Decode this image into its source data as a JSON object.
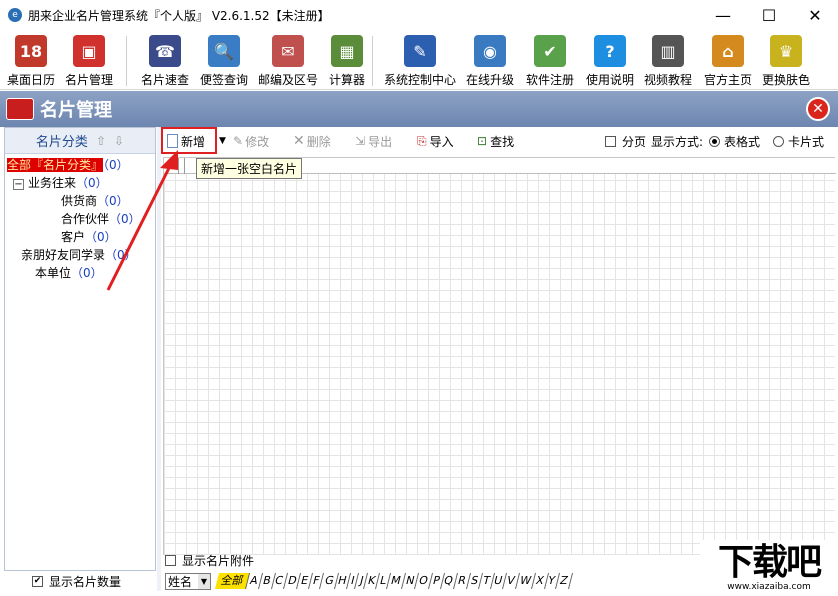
{
  "window": {
    "title": "朋来企业名片管理系统『个人版』 V2.6.1.52【未注册】",
    "minimize": "—",
    "maximize": "☐",
    "close": "✕"
  },
  "toolbar": {
    "items": [
      {
        "label": "桌面日历",
        "icon": "calendar-icon",
        "glyph": "18",
        "color": "#c0392b"
      },
      {
        "label": "名片管理",
        "icon": "cards-icon",
        "glyph": "▣",
        "color": "#d0312d"
      },
      {
        "label": "名片速查",
        "icon": "address-book-icon",
        "glyph": "☎",
        "color": "#3b4a8a"
      },
      {
        "label": "便签查询",
        "icon": "magnifier-icon",
        "glyph": "🔍",
        "color": "#3b7dc4"
      },
      {
        "label": "邮编及区号",
        "icon": "postcode-icon",
        "glyph": "✉",
        "color": "#c0504d"
      },
      {
        "label": "计算器",
        "icon": "calculator-icon",
        "glyph": "▦",
        "color": "#5b8c3a"
      },
      {
        "label": "系统控制中心",
        "icon": "control-center-icon",
        "glyph": "✎",
        "color": "#2d5fb0"
      },
      {
        "label": "在线升级",
        "icon": "globe-icon",
        "glyph": "◉",
        "color": "#3a7ac0"
      },
      {
        "label": "软件注册",
        "icon": "register-icon",
        "glyph": "✔",
        "color": "#5aa14b"
      },
      {
        "label": "使用说明",
        "icon": "help-icon",
        "glyph": "?",
        "color": "#1e8fe0"
      },
      {
        "label": "视频教程",
        "icon": "film-icon",
        "glyph": "▥",
        "color": "#555555"
      },
      {
        "label": "官方主页",
        "icon": "home-icon",
        "glyph": "⌂",
        "color": "#d48a1e"
      },
      {
        "label": "更换肤色",
        "icon": "skin-icon",
        "glyph": "♛",
        "color": "#c8b21e"
      }
    ]
  },
  "header": {
    "title": "名片管理",
    "close": "✕"
  },
  "left": {
    "title": "名片分类",
    "up": "⇧",
    "down": "⇩",
    "tree": [
      {
        "label": "全部『名片分类』",
        "count": "（0）"
      },
      {
        "label": "业务往来",
        "count": "（0）"
      },
      {
        "label": "供货商",
        "count": "（0）"
      },
      {
        "label": "合作伙伴",
        "count": "（0）"
      },
      {
        "label": "客户",
        "count": "（0）"
      },
      {
        "label": "亲朋好友同学录",
        "count": "（0）"
      },
      {
        "label": "本单位",
        "count": "（0）"
      }
    ],
    "expander": "−",
    "footer_checkbox": "显示名片数量",
    "footer_check": "✔"
  },
  "subbar": {
    "new": "新增",
    "edit": "修改",
    "delete": "删除",
    "export": "导出",
    "import": "导入",
    "find": "查找",
    "paging": "分页",
    "display_mode": "显示方式:",
    "table_mode": "表格式",
    "card_mode": "卡片式"
  },
  "tooltip": "新增一张空白名片",
  "bottom": {
    "show_attach": "显示名片附件",
    "sort_field": "姓名",
    "all": "全部",
    "letters": [
      "A",
      "B",
      "C",
      "D",
      "E",
      "F",
      "G",
      "H",
      "I",
      "J",
      "K",
      "L",
      "M",
      "N",
      "O",
      "P",
      "Q",
      "R",
      "S",
      "T",
      "U",
      "V",
      "W",
      "X",
      "Y",
      "Z"
    ]
  },
  "watermark": {
    "brand": "下载吧",
    "site": "www.xiazaiba.com"
  }
}
